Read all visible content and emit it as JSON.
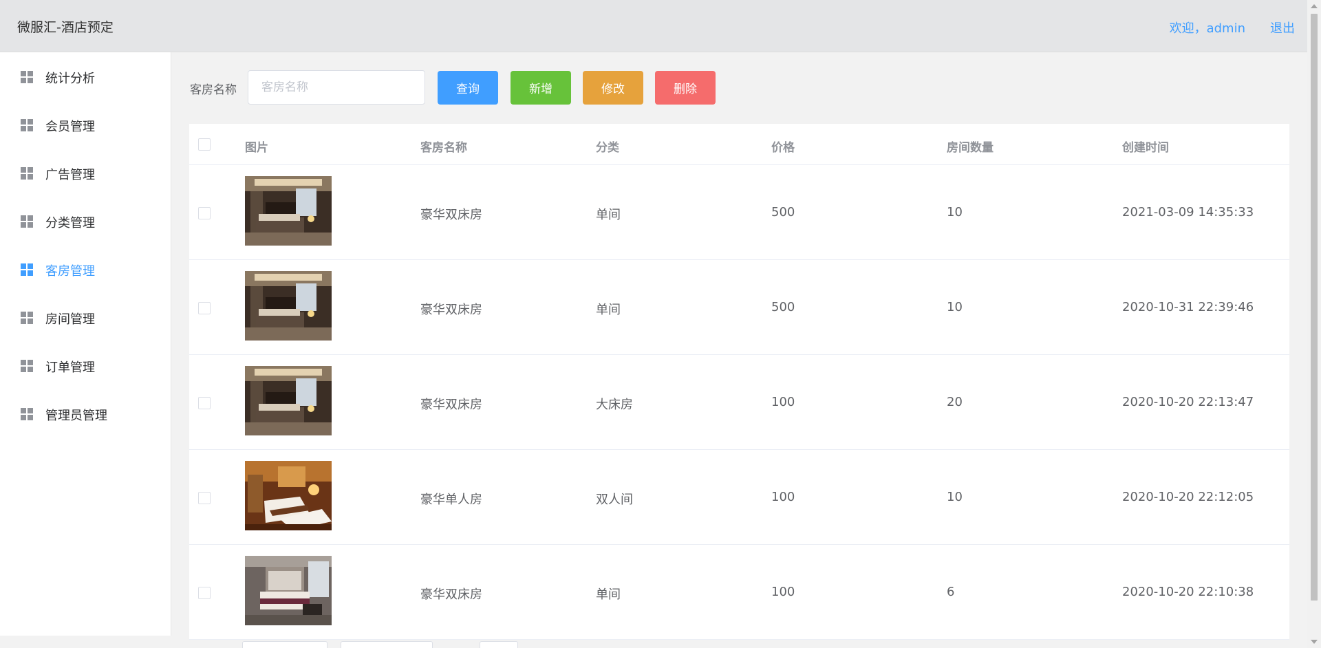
{
  "header": {
    "brand": "微服汇-酒店预定",
    "welcome": "欢迎，admin",
    "logout": "退出"
  },
  "sidebar": {
    "items": [
      {
        "label": "统计分析",
        "active": false
      },
      {
        "label": "会员管理",
        "active": false
      },
      {
        "label": "广告管理",
        "active": false
      },
      {
        "label": "分类管理",
        "active": false
      },
      {
        "label": "客房管理",
        "active": true
      },
      {
        "label": "房间管理",
        "active": false
      },
      {
        "label": "订单管理",
        "active": false
      },
      {
        "label": "管理员管理",
        "active": false
      }
    ]
  },
  "toolbar": {
    "search_label": "客房名称",
    "search_placeholder": "客房名称",
    "search_value": "",
    "query": "查询",
    "add": "新增",
    "edit": "修改",
    "delete": "删除"
  },
  "table": {
    "headers": [
      "图片",
      "客房名称",
      "分类",
      "价格",
      "房间数量",
      "创建时间"
    ],
    "rows": [
      {
        "image": "hotel-room-photo",
        "name": "豪华双床房",
        "category": "单间",
        "price": "500",
        "count": "10",
        "created": "2021-03-09 14:35:33"
      },
      {
        "image": "hotel-room-photo",
        "name": "豪华双床房",
        "category": "单间",
        "price": "500",
        "count": "10",
        "created": "2020-10-31 22:39:46"
      },
      {
        "image": "hotel-room-photo",
        "name": "豪华双床房",
        "category": "大床房",
        "price": "100",
        "count": "20",
        "created": "2020-10-20 22:13:47"
      },
      {
        "image": "twin-bed-room-photo",
        "name": "豪华单人房",
        "category": "双人间",
        "price": "100",
        "count": "10",
        "created": "2020-10-20 22:12:05"
      },
      {
        "image": "suite-room-photo",
        "name": "豪华双床房",
        "category": "单间",
        "price": "100",
        "count": "6",
        "created": "2020-10-20 22:10:38"
      }
    ]
  },
  "colors": {
    "primary": "#409eff",
    "success": "#67c23a",
    "warning": "#e6a23c",
    "danger": "#f56c6c"
  }
}
